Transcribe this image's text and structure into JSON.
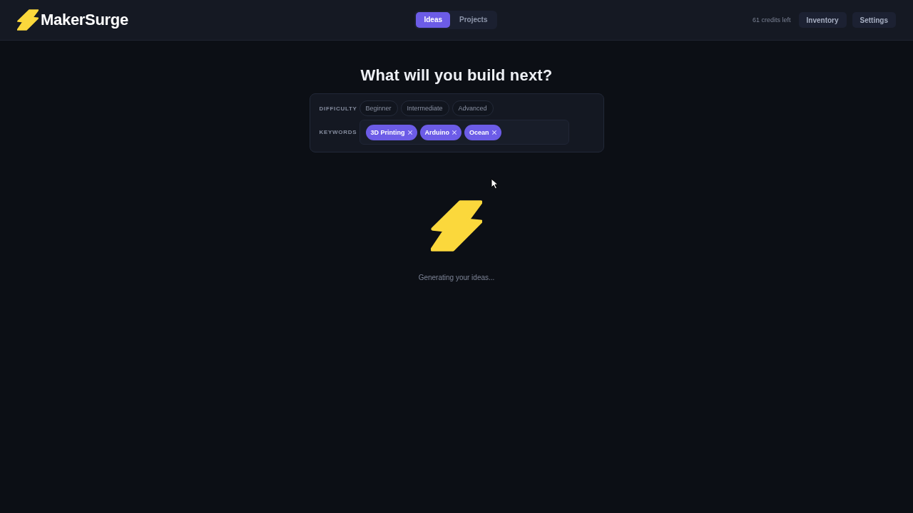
{
  "header": {
    "logo": {
      "text": "MakerSurge"
    },
    "tabs": [
      {
        "label": "Ideas",
        "selected": true
      },
      {
        "label": "Projects",
        "selected": false
      }
    ],
    "credits": "61 credits left",
    "buttons": [
      "Inventory",
      "Settings"
    ]
  },
  "heading": "What will you build next?",
  "filters": {
    "difficulty": {
      "label": "DIFFICULTY",
      "options": [
        {
          "label": "Beginner",
          "selected": false
        },
        {
          "label": "Intermediate",
          "selected": false
        },
        {
          "label": "Advanced",
          "selected": false
        }
      ]
    },
    "keywords": {
      "label": "KEYWORDS",
      "chips": [
        "3D Printing",
        "Arduino",
        "Ocean"
      ]
    }
  },
  "loading": {
    "message": "Generating your ideas..."
  }
}
